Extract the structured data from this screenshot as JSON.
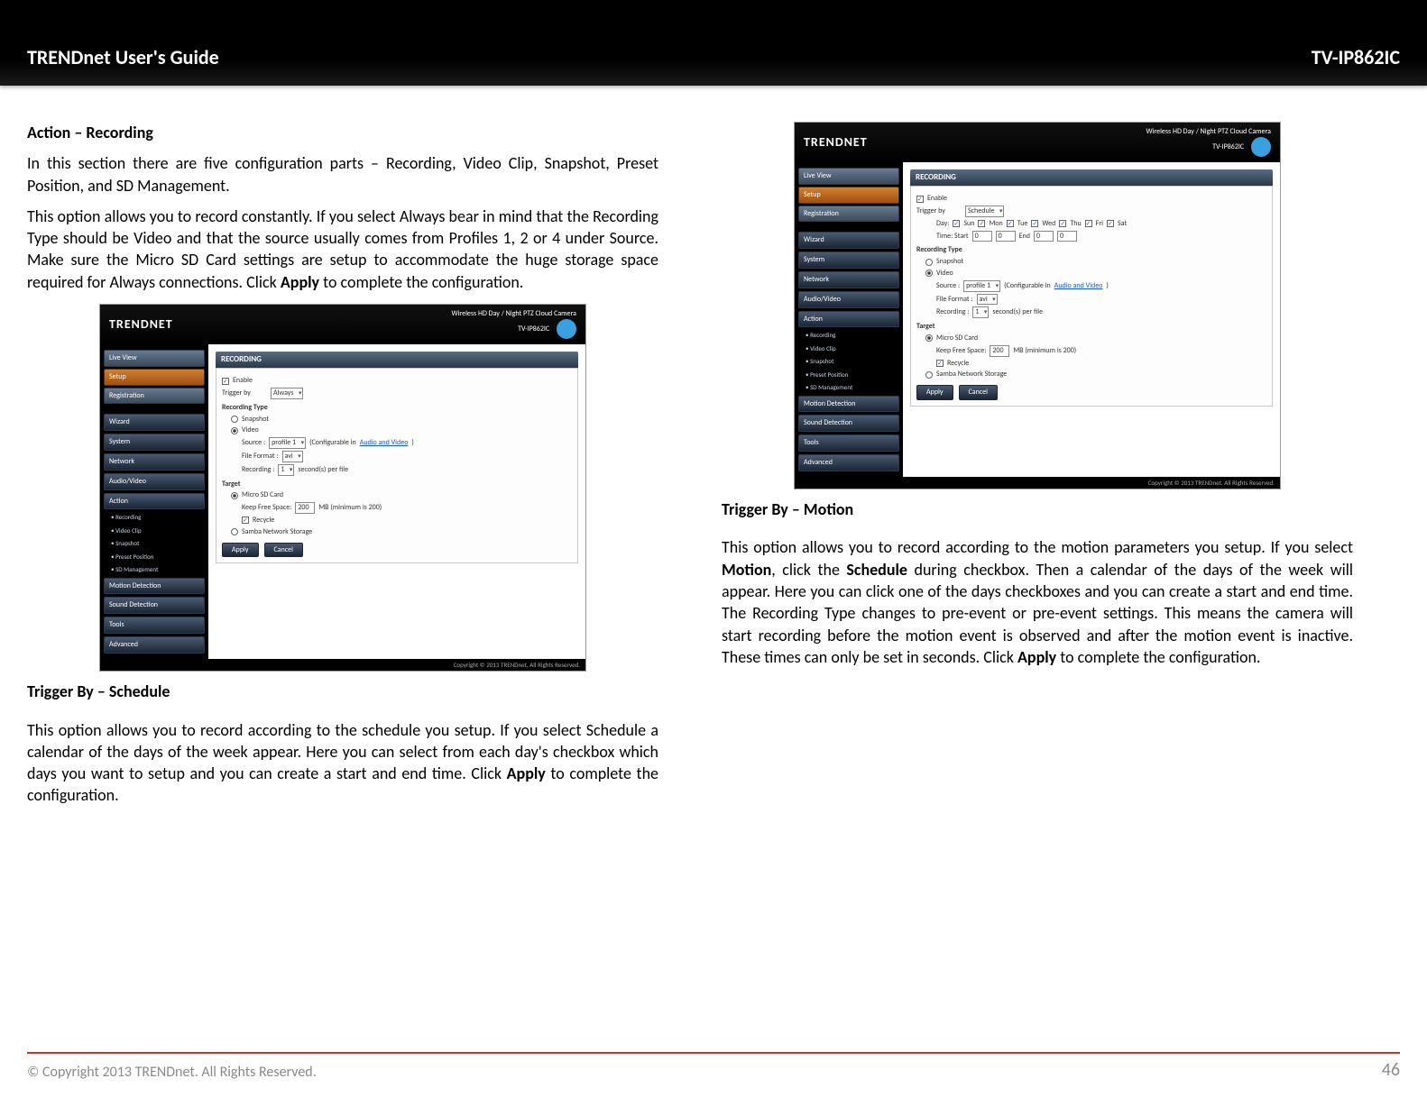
{
  "header": {
    "left": "TRENDnet User's Guide",
    "right": "TV-IP862IC"
  },
  "left_col": {
    "title": "Action – Recording",
    "p1": "In this section there are five configuration parts – Recording, Video Clip, Snapshot, Preset Position, and SD Management.",
    "p2_a": "This option allows you to record constantly. If you select Always bear in mind that the Recording Type should be Video and that the source usually comes from Profiles 1, 2 or 4 under Source. Make sure the Micro SD Card settings are setup to accommodate the huge storage space required for Always connections. Click ",
    "p2_bold": "Apply",
    "p2_b": " to complete the configuration.",
    "sub": "Trigger By – Schedule",
    "p3_a": "This option allows you to record according to the schedule you setup. If you select Schedule a calendar of the days of the week appear. Here you can select from each day's checkbox which days you want to setup and you can create a start and end time. Click ",
    "p3_bold": "Apply",
    "p3_b": " to complete the configuration."
  },
  "right_col": {
    "sub": "Trigger By – Motion",
    "p1_a": "This option allows you to record according to the motion parameters you setup. If you select ",
    "p1_b1": "Motion",
    "p1_b": ", click the ",
    "p1_b2": "Schedule",
    "p1_c": " during checkbox. Then a calendar of the days of the week will appear. Here you can click one of the days checkboxes and you can create a start and end time. The Recording Type changes to pre-event or pre-event settings. This means the camera will start recording before the motion event is observed and after the motion event is inactive. These times can only be set in seconds. Click ",
    "p1_b3": "Apply",
    "p1_d": " to complete the configuration."
  },
  "ss_common": {
    "brand": "TRENDNET",
    "model_line1": "Wireless HD Day / Night PTZ Cloud Camera",
    "model_line2": "TV-IP862IC",
    "top_btns": [
      "Live View",
      "Setup",
      "Registration"
    ],
    "nav": [
      "Wizard",
      "System",
      "Network",
      "Audio/Video",
      "Action"
    ],
    "action_sub": [
      "• Recording",
      "• Video Clip",
      "• Snapshot",
      "• Preset Position",
      "• SD Management"
    ],
    "nav2": [
      "Motion Detection",
      "Sound Detection",
      "Tools",
      "Advanced"
    ],
    "panel_title": "RECORDING",
    "enable": "Enable",
    "trigger_by": "Trigger by",
    "rec_type": "Recording Type",
    "snapshot": "Snapshot",
    "video": "Video",
    "source": "Source :",
    "profile": "profile 1",
    "config_in": "(Configurable in ",
    "av_link": "Audio and Video",
    "file_format": "File Format :",
    "avi": "avi",
    "recording": "Recording :",
    "one": "1",
    "seconds_per": "second(s) per file",
    "target": "Target",
    "micro_sd": "Micro SD Card",
    "keep_free": "Keep Free Space:",
    "kf_val": "200",
    "kf_hint": "MB (minimum is 200)",
    "recycle": "Recycle",
    "samba": "Samba Network Storage",
    "apply": "Apply",
    "cancel": "Cancel",
    "footer": "Copyright © 2013 TRENDnet. All Rights Reserved."
  },
  "ss1": {
    "trigger_val": "Always"
  },
  "ss2": {
    "trigger_val": "Schedule",
    "day_label": "Day:",
    "days": [
      "Sun",
      "Mon",
      "Tue",
      "Wed",
      "Thu",
      "Fri",
      "Sat"
    ],
    "time_label": "Time: Start",
    "t0a": "0",
    "t0b": "0",
    "end": "End",
    "t1a": "0",
    "t1b": "0"
  },
  "footer": {
    "copyright": "© Copyright 2013 TRENDnet. All Rights Reserved.",
    "page": "46"
  }
}
